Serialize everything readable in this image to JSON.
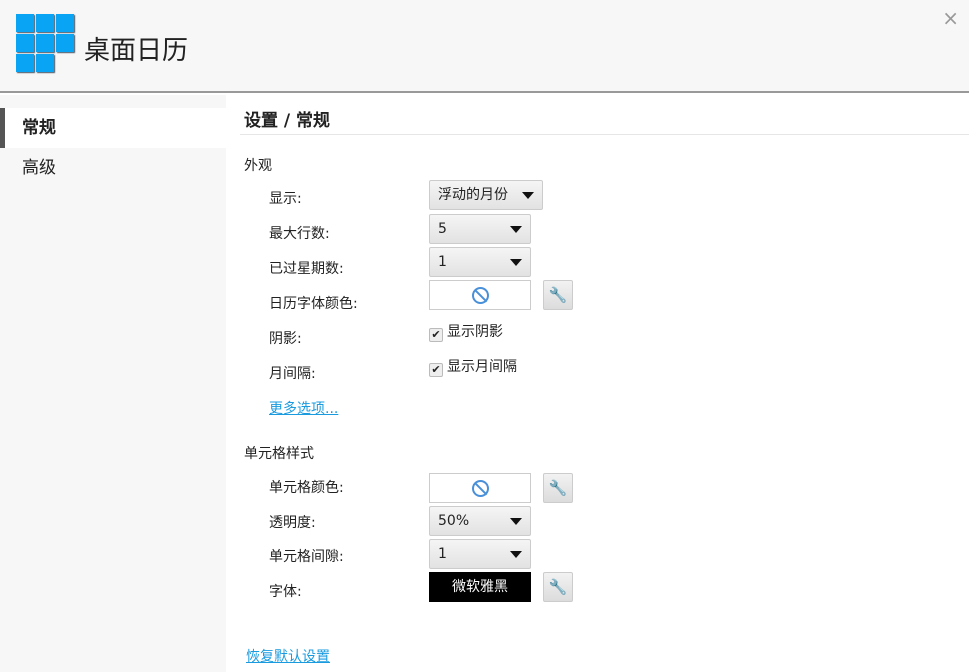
{
  "header": {
    "title": "桌面日历",
    "close": "×"
  },
  "sidebar": {
    "items": [
      {
        "label": "常规"
      },
      {
        "label": "高级"
      }
    ]
  },
  "main": {
    "title": "设置 / 常规",
    "appearance": {
      "heading": "外观",
      "display_label": "显示:",
      "display_value": "浮动的月份",
      "max_rows_label": "最大行数:",
      "max_rows_value": "5",
      "past_weeks_label": "已过星期数:",
      "past_weeks_value": "1",
      "font_color_label": "日历字体颜色:",
      "shadow_label": "阴影:",
      "shadow_checkbox": "显示阴影",
      "shadow_checked": true,
      "month_gap_label": "月间隔:",
      "month_gap_checkbox": "显示月间隔",
      "month_gap_checked": true,
      "more_options": "更多选项..."
    },
    "cell": {
      "heading": "单元格样式",
      "color_label": "单元格颜色:",
      "opacity_label": "透明度:",
      "opacity_value": "50%",
      "gap_label": "单元格间隙:",
      "gap_value": "1",
      "font_label": "字体:",
      "font_value": "微软雅黑"
    },
    "reset": "恢复默认设置"
  }
}
